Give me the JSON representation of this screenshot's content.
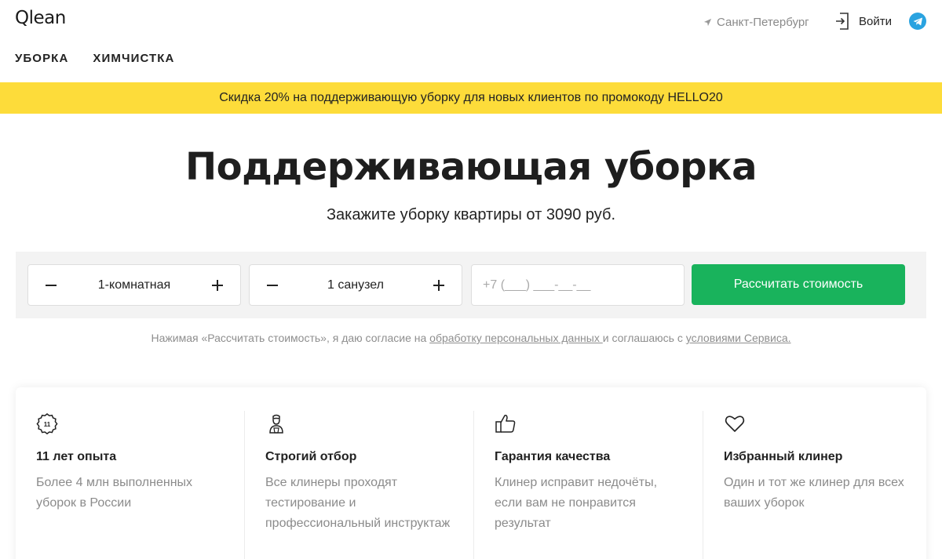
{
  "header": {
    "logo": "Qlean",
    "city": "Санкт-Петербург",
    "login": "Войти",
    "nav": [
      "УБОРКА",
      "ХИМЧИСТКА"
    ]
  },
  "promo": "Скидка 20% на поддерживающую уборку для новых клиентов по промокоду HELLO20",
  "hero": {
    "title": "Поддерживающая уборка",
    "subtitle": "Закажите уборку квартиры от 3090 руб."
  },
  "form": {
    "rooms": "1-комнатная",
    "baths": "1 санузел",
    "phone_placeholder": "+7 (___) ___-__-__",
    "submit": "Рассчитать стоимость"
  },
  "consent": {
    "before": "Нажимая «Рассчитать стоимость», я даю согласие на ",
    "link1": "обработку персональных данных ",
    "middle": "и соглашаюсь с ",
    "link2": "условиями Сервиса."
  },
  "features": [
    {
      "icon": "medal-11-icon",
      "title": "11 лет опыта",
      "text": "Более 4 млн выполненных уборок в России"
    },
    {
      "icon": "cleaner-person-icon",
      "title": "Строгий отбор",
      "text": "Все клинеры проходят тестирование и профессиональный инструктаж"
    },
    {
      "icon": "thumbs-up-icon",
      "title": "Гарантия качества",
      "text": "Клинер исправит недочёты, если вам не понравится результат"
    },
    {
      "icon": "heart-icon",
      "title": "Избранный клинер",
      "text": "Один и тот же клинер для всех ваших уборок"
    }
  ],
  "colors": {
    "accent_green": "#19b35c",
    "promo_yellow": "#fddc3a",
    "telegram_blue": "#2aa3e0"
  }
}
